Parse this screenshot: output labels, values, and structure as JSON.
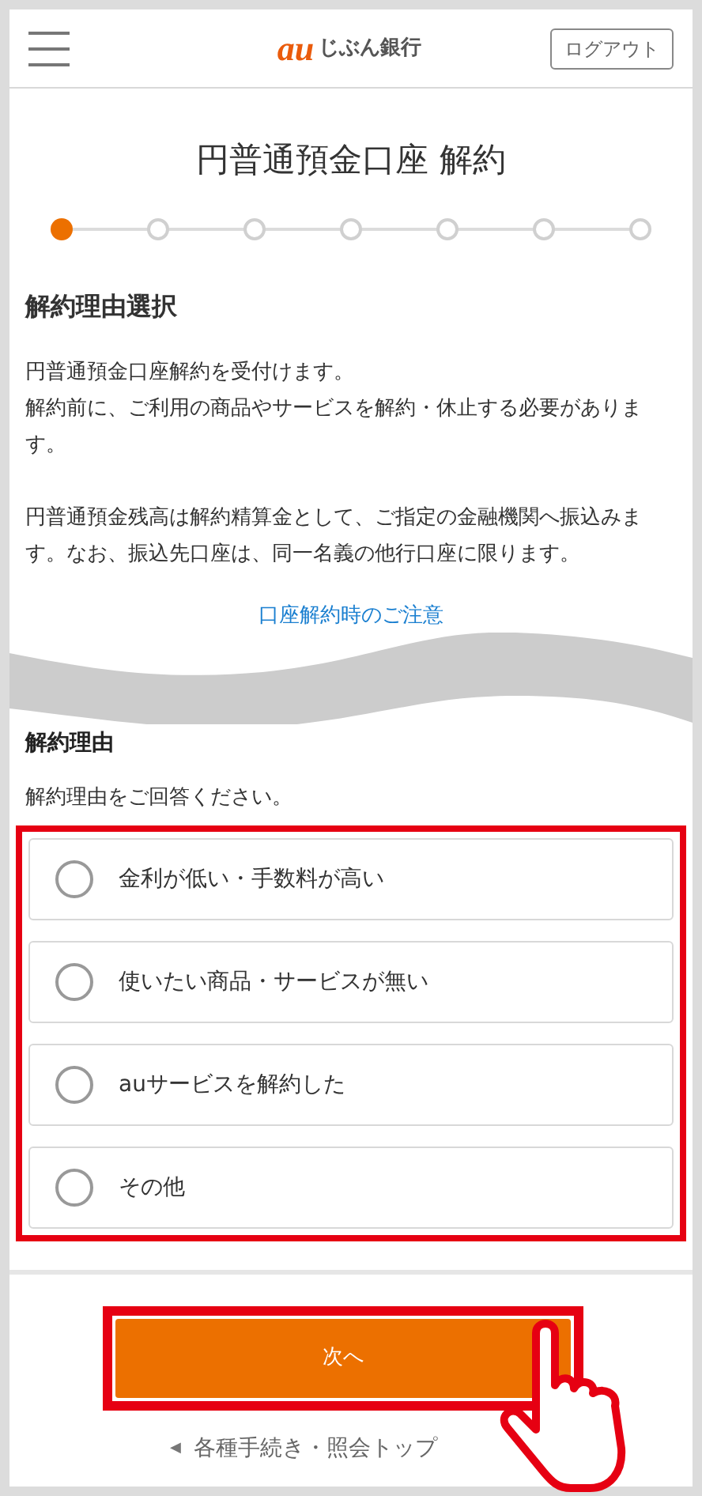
{
  "header": {
    "logo_mark": "au",
    "logo_text": "じぶん銀行",
    "logout_button": "ログアウト"
  },
  "title": "円普通預金口座 解約",
  "steps": [
    {
      "selected": true
    },
    {
      "selected": false
    },
    {
      "selected": false
    },
    {
      "selected": false
    },
    {
      "selected": false
    },
    {
      "selected": false
    },
    {
      "selected": false
    }
  ],
  "section_heading": "解約理由選択",
  "paragraphs": [
    {
      "lines": [
        "円普通預金口座解約を受付けます。",
        "解約前に、ご利用の商品やサービスを解約・休止する必要があります。"
      ]
    },
    {
      "lines": [
        "円普通預金残高は解約精算金として、ご指定の金融機関へ振込みます。なお、振込先口座は、同一名義の他行口座に限ります。"
      ]
    }
  ],
  "notice_link": "口座解約時のご注意",
  "reason_heading": "解約理由",
  "reason_prompt": "解約理由をご回答ください。",
  "reasons": [
    {
      "label": "金利が低い・手数料が高い",
      "selected": false
    },
    {
      "label": "使いたい商品・サービスが無い",
      "selected": false
    },
    {
      "label": "auサービスを解約した",
      "selected": false
    },
    {
      "label": "その他",
      "selected": false
    }
  ],
  "next_button": "次へ",
  "back_link": {
    "arrow": "◀",
    "label": "各種手続き・照会トップ"
  }
}
